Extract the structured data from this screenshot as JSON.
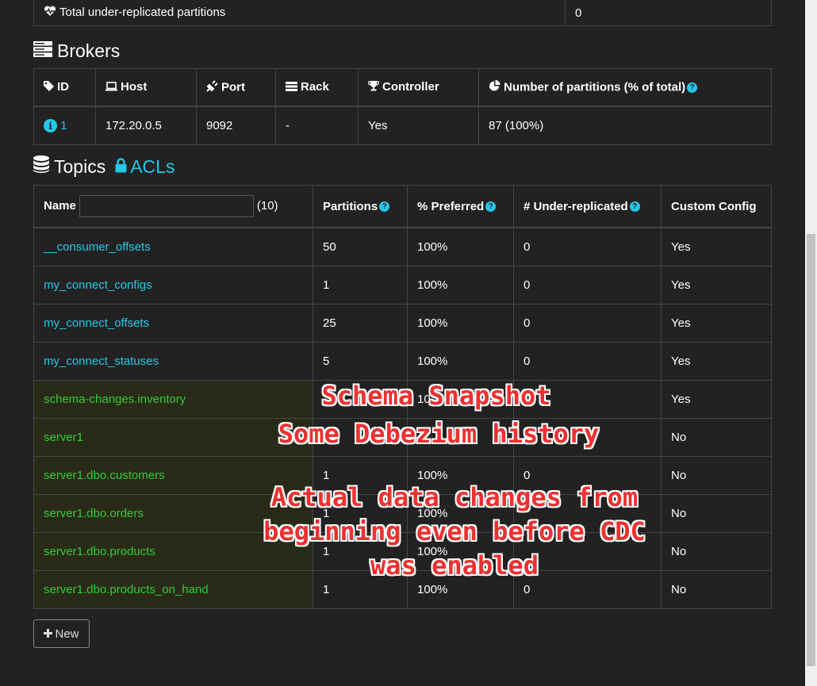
{
  "summary": {
    "label": "Total under-replicated partitions",
    "value": "0"
  },
  "brokers": {
    "title": "Brokers",
    "headers": {
      "id": "ID",
      "host": "Host",
      "port": "Port",
      "rack": "Rack",
      "controller": "Controller",
      "partitions": "Number of partitions (% of total)"
    },
    "rows": [
      {
        "id": "1",
        "host": "172.20.0.5",
        "port": "9092",
        "rack": "-",
        "controller": "Yes",
        "partitions": "87 (100%)"
      }
    ]
  },
  "topics": {
    "title": "Topics",
    "acls_label": "ACLs",
    "headers": {
      "name": "Name",
      "count": "(10)",
      "partitions": "Partitions",
      "preferred": "% Preferred",
      "under_replicated": "# Under-replicated",
      "custom_config": "Custom Config"
    },
    "name_filter_value": "",
    "rows": [
      {
        "name": "__consumer_offsets",
        "partitions": "50",
        "preferred": "100%",
        "under": "0",
        "custom": "Yes",
        "color": "cyan"
      },
      {
        "name": "my_connect_configs",
        "partitions": "1",
        "preferred": "100%",
        "under": "0",
        "custom": "Yes",
        "color": "cyan"
      },
      {
        "name": "my_connect_offsets",
        "partitions": "25",
        "preferred": "100%",
        "under": "0",
        "custom": "Yes",
        "color": "cyan"
      },
      {
        "name": "my_connect_statuses",
        "partitions": "5",
        "preferred": "100%",
        "under": "0",
        "custom": "Yes",
        "color": "cyan"
      },
      {
        "name": "schema-changes.inventory",
        "partitions": "",
        "preferred": "10",
        "under": "",
        "custom": "Yes",
        "color": "green"
      },
      {
        "name": "server1",
        "partitions": "",
        "preferred": "",
        "under": "",
        "custom": "No",
        "color": "green"
      },
      {
        "name": "server1.dbo.customers",
        "partitions": "1",
        "preferred": "100%",
        "under": "0",
        "custom": "No",
        "color": "green"
      },
      {
        "name": "server1.dbo.orders",
        "partitions": "1",
        "preferred": "100%",
        "under": "",
        "custom": "No",
        "color": "green"
      },
      {
        "name": "server1.dbo.products",
        "partitions": "1",
        "preferred": "100%",
        "under": "",
        "custom": "No",
        "color": "green"
      },
      {
        "name": "server1.dbo.products_on_hand",
        "partitions": "1",
        "preferred": "100%",
        "under": "0",
        "custom": "No",
        "color": "green"
      }
    ]
  },
  "new_button": "New",
  "annotations": {
    "line1": "Schema Snapshot",
    "line2": "Some Debezium history",
    "line3": "Actual data changes from",
    "line4": "beginning even before CDC",
    "line5": "was enabled"
  },
  "colors": {
    "background": "#222222",
    "link": "#24c8e8",
    "highlight_green": "#32cd32",
    "annotation_red": "#ee3030"
  }
}
